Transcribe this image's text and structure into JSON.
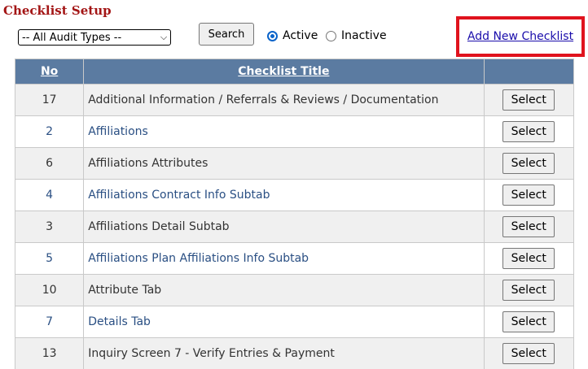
{
  "page": {
    "title": "Checklist Setup"
  },
  "filters": {
    "audit_type_selected": "-- All Audit Types --",
    "search_label": "Search",
    "status_options": [
      {
        "label": "Active",
        "checked": true
      },
      {
        "label": "Inactive",
        "checked": false
      }
    ]
  },
  "actions": {
    "add_new_label": "Add New Checklist",
    "highlight_color": "#e0131d"
  },
  "table": {
    "headers": {
      "no": "No",
      "title": "Checklist Title",
      "action": ""
    },
    "rows": [
      {
        "no": "17",
        "title": "Additional Information / Referrals & Reviews / Documentation",
        "action": "Select"
      },
      {
        "no": "2",
        "title": "Affiliations",
        "action": "Select"
      },
      {
        "no": "6",
        "title": "Affiliations Attributes",
        "action": "Select"
      },
      {
        "no": "4",
        "title": "Affiliations Contract Info Subtab",
        "action": "Select"
      },
      {
        "no": "3",
        "title": "Affiliations Detail Subtab",
        "action": "Select"
      },
      {
        "no": "5",
        "title": "Affiliations Plan Affiliations Info Subtab",
        "action": "Select"
      },
      {
        "no": "10",
        "title": "Attribute Tab",
        "action": "Select"
      },
      {
        "no": "7",
        "title": "Details Tab",
        "action": "Select"
      },
      {
        "no": "13",
        "title": "Inquiry Screen 7 - Verify Entries & Payment",
        "action": "Select"
      }
    ]
  },
  "colors": {
    "title_red": "#a31515",
    "header_bg": "#5b7ba1",
    "link_blue": "#1a0dab",
    "row_link_text": "#2a4f83"
  }
}
